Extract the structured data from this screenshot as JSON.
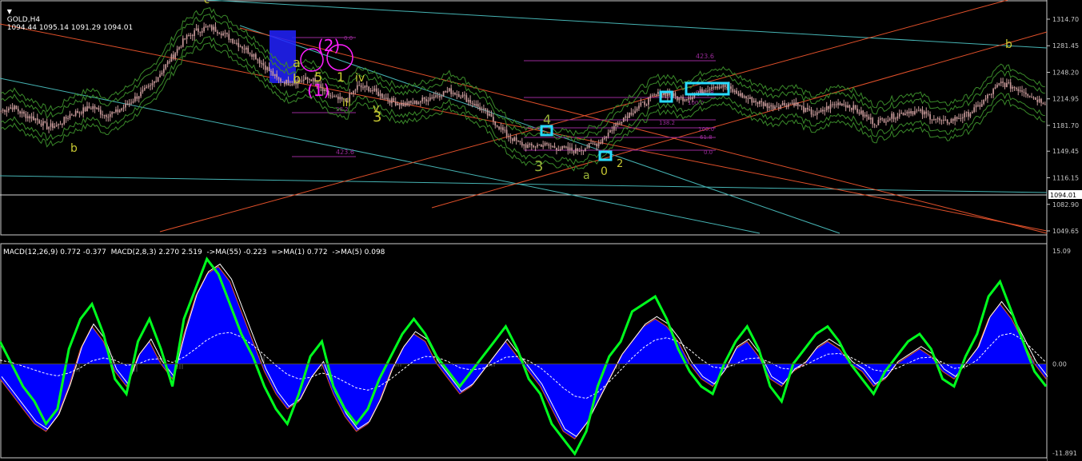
{
  "window": {
    "symbol_label": "GOLD,H4",
    "ohlc": "1094.44 1095.14 1091.29 1094.01",
    "menu_icon": "triangle-down-icon"
  },
  "colors": {
    "background": "#000000",
    "candles": "#c89a9a",
    "envelope": "#3a8a2a",
    "macd_fill": "#0000ff",
    "macd_signal_fast": "#00ff1e",
    "trend_cyan": "#46b4b4",
    "trend_orange": "#e0502a",
    "fib_purple": "#9a2a9a",
    "wave_yellow": "#c8c832",
    "wave_magenta": "#ff1eff",
    "box_cyan": "#28dcff"
  },
  "price_scale": {
    "labels": [
      "1314.70",
      "1281.45",
      "1248.20",
      "1214.95",
      "1181.70",
      "1149.45",
      "1116.15",
      "1082.90",
      "1049.65"
    ],
    "current": "1094.01"
  },
  "macd_panel": {
    "legend": "MACD(12,26,9) 0.772 -0.377  MACD(2,8,3) 2.270 2.519  ->MA(55) -0.223  =>MA(1) 0.772  ->MA(5) 0.098",
    "scale_labels": [
      "15.09",
      "0.00",
      "-11.891"
    ]
  },
  "wave_labels": {
    "b_left": "b",
    "yellow_3_left": "3",
    "green_3": "3",
    "green_4": "4",
    "green_a": "a",
    "zero": "0",
    "two": "2",
    "iii": "iii",
    "iv": "iv",
    "v": "v",
    "b_right": "b",
    "one_paren": "(1)",
    "two_paren": "(2)",
    "one": "1",
    "b_small": "b",
    "five": "5",
    "c": "c",
    "a": "a"
  },
  "fib_labels": {
    "f1": "423.6",
    "f2": "423.6",
    "f3": "261.8",
    "f4": "138.2",
    "f5": "100.0",
    "f6": "61.8",
    "f7": "0.0",
    "f8": "0.0",
    "f9": "100.0",
    "f10": "38.2"
  },
  "chart_data": [
    {
      "type": "candlestick",
      "title": "GOLD,H4",
      "ylim": [
        1049.65,
        1314.7
      ],
      "y_ticks": [
        1314.7,
        1281.45,
        1248.2,
        1214.95,
        1181.7,
        1149.45,
        1116.15,
        1082.9,
        1049.65
      ],
      "current_price": 1094.01,
      "close_path": [
        1200,
        1205,
        1195,
        1190,
        1180,
        1182,
        1195,
        1200,
        1205,
        1195,
        1198,
        1208,
        1220,
        1230,
        1250,
        1270,
        1290,
        1300,
        1305,
        1300,
        1290,
        1280,
        1270,
        1255,
        1240,
        1235,
        1238,
        1240,
        1225,
        1215,
        1212,
        1230,
        1228,
        1220,
        1212,
        1208,
        1210,
        1215,
        1220,
        1225,
        1220,
        1210,
        1200,
        1185,
        1170,
        1160,
        1155,
        1158,
        1155,
        1152,
        1150,
        1155,
        1160,
        1175,
        1190,
        1200,
        1210,
        1220,
        1222,
        1215,
        1218,
        1225,
        1232,
        1230,
        1222,
        1215,
        1210,
        1205,
        1208,
        1210,
        1200,
        1195,
        1205,
        1210,
        1205,
        1195,
        1185,
        1190,
        1195,
        1200,
        1198,
        1192,
        1185,
        1190,
        1195,
        1205,
        1220,
        1235,
        1230,
        1225,
        1215,
        1210
      ]
    },
    {
      "type": "area",
      "title": "MACD(12,26,9) 0.772 -0.377",
      "ylim": [
        -11.891,
        15.09
      ],
      "main_path": [
        -2,
        -4,
        -6,
        -8,
        -9,
        -7,
        -3,
        2,
        5,
        3,
        -1,
        -3,
        1,
        3,
        0,
        -2,
        4,
        9,
        12,
        13,
        11,
        7,
        3,
        -1,
        -4,
        -6,
        -5,
        -2,
        0,
        -4,
        -7,
        -9,
        -8,
        -5,
        -1,
        2,
        4,
        3,
        0,
        -2,
        -4,
        -3,
        -1,
        1,
        3,
        1,
        -1,
        -3,
        -6,
        -9,
        -10,
        -8,
        -5,
        -2,
        1,
        3,
        5,
        6,
        5,
        3,
        0,
        -2,
        -3,
        -1,
        2,
        3,
        1,
        -2,
        -3,
        -1,
        0,
        2,
        3,
        2,
        0,
        -1,
        -3,
        -2,
        0,
        1,
        2,
        1,
        -1,
        -2,
        0,
        2,
        6,
        8,
        6,
        3,
        0,
        -2
      ],
      "fast_path": [
        3,
        0,
        -3,
        -5,
        -8,
        -6,
        2,
        6,
        8,
        4,
        -2,
        -4,
        3,
        6,
        2,
        -3,
        6,
        10,
        14,
        12,
        8,
        4,
        1,
        -3,
        -6,
        -8,
        -4,
        1,
        3,
        -3,
        -6,
        -8,
        -6,
        -2,
        1,
        4,
        6,
        4,
        1,
        -1,
        -3,
        -1,
        1,
        3,
        5,
        2,
        -2,
        -4,
        -8,
        -10,
        -12,
        -9,
        -3,
        1,
        3,
        7,
        8,
        9,
        6,
        2,
        -1,
        -3,
        -4,
        0,
        3,
        5,
        2,
        -3,
        -5,
        0,
        2,
        4,
        5,
        3,
        0,
        -2,
        -4,
        -1,
        1,
        3,
        4,
        2,
        -2,
        -3,
        1,
        4,
        9,
        11,
        7,
        3,
        -1,
        -3
      ],
      "signal_path": [
        0.5,
        0.2,
        -0.3,
        -0.8,
        -1.3,
        -1.6,
        -1.2,
        -0.5,
        0.4,
        0.8,
        0.5,
        -0.2,
        0.0,
        0.6,
        0.7,
        0.2,
        0.9,
        2.0,
        3.2,
        4.0,
        4.2,
        3.6,
        2.5,
        1.2,
        -0.2,
        -1.4,
        -2.0,
        -1.8,
        -1.2,
        -1.6,
        -2.4,
        -3.2,
        -3.5,
        -3.0,
        -2.0,
        -0.8,
        0.4,
        1.0,
        0.9,
        0.3,
        -0.5,
        -0.8,
        -0.6,
        0.1,
        0.9,
        1.0,
        0.4,
        -0.5,
        -1.8,
        -3.2,
        -4.3,
        -4.6,
        -3.8,
        -2.4,
        -0.8,
        0.8,
        2.2,
        3.2,
        3.5,
        3.0,
        1.9,
        0.6,
        -0.4,
        -0.6,
        0.0,
        0.7,
        0.8,
        0.2,
        -0.6,
        -0.7,
        -0.2,
        0.6,
        1.3,
        1.4,
        0.9,
        0.1,
        -0.8,
        -1.0,
        -0.6,
        0.1,
        0.8,
        0.9,
        0.2,
        -0.6,
        -0.4,
        0.5,
        2.2,
        3.8,
        4.1,
        3.2,
        1.7,
        0.2
      ]
    }
  ]
}
